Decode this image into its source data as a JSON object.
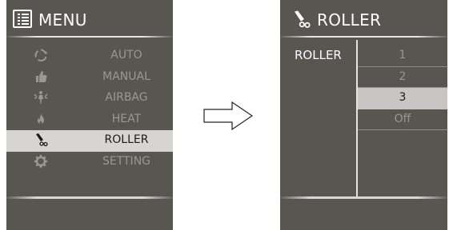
{
  "menu_screen": {
    "title": "MENU",
    "items": [
      {
        "label": "AUTO",
        "icon": "auto-cycle-icon",
        "selected": false
      },
      {
        "label": "MANUAL",
        "icon": "thumb-up-icon",
        "selected": false
      },
      {
        "label": "AIRBAG",
        "icon": "airbag-person-icon",
        "selected": false
      },
      {
        "label": "HEAT",
        "icon": "flame-icon",
        "selected": false
      },
      {
        "label": "ROLLER",
        "icon": "roller-icon",
        "selected": true
      },
      {
        "label": "SETTING",
        "icon": "gear-icon",
        "selected": false
      }
    ]
  },
  "roller_screen": {
    "title": "ROLLER",
    "section_label": "ROLLER",
    "options": [
      {
        "label": "1",
        "selected": false
      },
      {
        "label": "2",
        "selected": false
      },
      {
        "label": "3",
        "selected": true
      },
      {
        "label": "Off",
        "selected": false
      }
    ]
  },
  "colors": {
    "panel_bg": "#595551",
    "highlight_bg": "#d6d5d3",
    "inactive_text": "#9b9791",
    "title_text": "#ffffff"
  }
}
